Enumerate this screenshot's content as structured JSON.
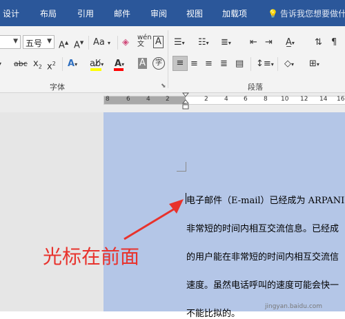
{
  "tabs": [
    "设计",
    "布局",
    "引用",
    "邮件",
    "审阅",
    "视图",
    "加载项"
  ],
  "tell_me": "告诉我您想要做什",
  "font": {
    "size_value": "五号"
  },
  "groups": {
    "font_label": "字体",
    "paragraph_label": "段落"
  },
  "ruler": {
    "numbers": [
      "8",
      "6",
      "4",
      "2",
      "2",
      "4",
      "6",
      "8",
      "10",
      "12",
      "14",
      "16"
    ]
  },
  "document": {
    "lines": [
      "电子邮件（E-mail）已经成为 ARPANI",
      "非常短的时间内相互交流信息。已经成",
      "的用户能在非常短的时间内相互交流信",
      "速度。虽然电话呼叫的速度可能会快一",
      "不能比拟的。"
    ]
  },
  "annotation": {
    "text": "光标在前面",
    "color": "#e8322c"
  },
  "watermark": "jingyan.baidu.com",
  "colors": {
    "ribbon_tab": "#2b579a",
    "page_bg": "#b4c6e7",
    "highlight_bar": "#ffff00",
    "font_color_bar": "#ff0000"
  }
}
